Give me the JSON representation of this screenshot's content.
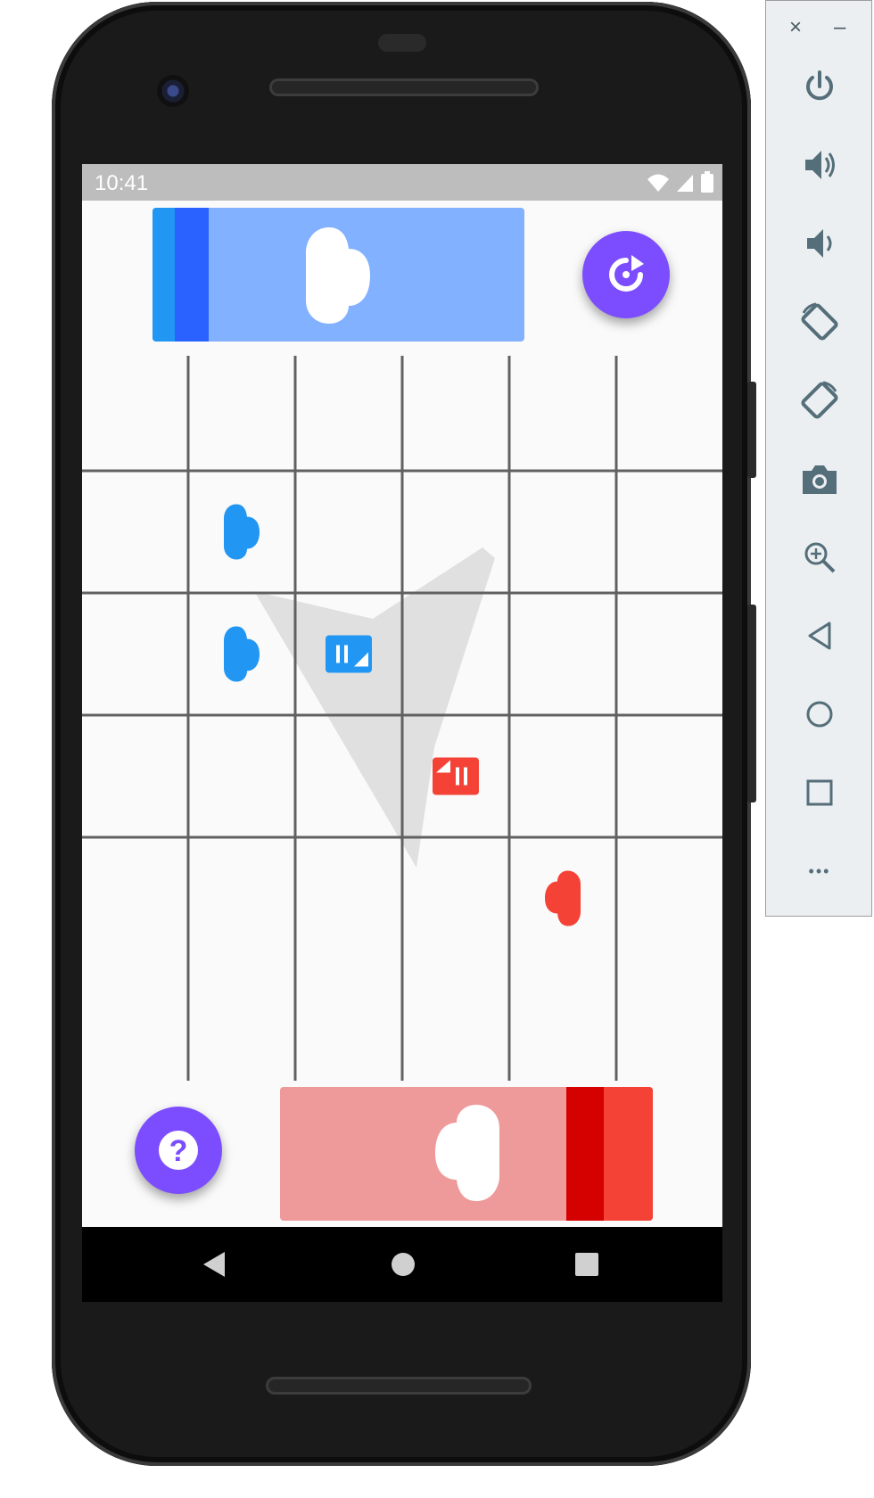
{
  "status_bar": {
    "time": "10:41"
  },
  "colors": {
    "blue_player": "#2196f3",
    "blue_panel": "#82b1ff",
    "blue_stripe_light": "#2196f3",
    "blue_stripe_dark": "#2962ff",
    "red_player": "#f44336",
    "red_panel": "#ef9a9a",
    "red_stripe_dark": "#d50000",
    "red_stripe_light": "#f44336",
    "fab": "#7c4dff",
    "screen_bg": "#fafafa"
  },
  "board": {
    "columns": 6,
    "rows": 6,
    "pieces": [
      {
        "player": "blue",
        "type": "cloud-piece",
        "col": 2,
        "row": 2
      },
      {
        "player": "blue",
        "type": "cloud-piece",
        "col": 2,
        "row": 3
      },
      {
        "player": "blue",
        "type": "note-piece",
        "col": 3,
        "row": 3
      },
      {
        "player": "red",
        "type": "note-piece",
        "col": 4,
        "row": 4
      },
      {
        "player": "red",
        "type": "cloud-piece",
        "col": 5,
        "row": 5
      }
    ]
  },
  "top_panel": {
    "icon": "cloud-icon",
    "player": "blue"
  },
  "bottom_panel": {
    "icon": "cloud-icon",
    "player": "red"
  },
  "buttons": {
    "restart_icon": "restart-icon",
    "help_icon": "help-icon",
    "help_glyph": "?"
  },
  "toolbar": {
    "close": "×",
    "minimize": "–",
    "items": [
      "power-icon",
      "volume-up-icon",
      "volume-down-icon",
      "rotate-left-icon",
      "rotate-right-icon",
      "camera-icon",
      "zoom-icon",
      "back-icon",
      "home-icon",
      "overview-icon",
      "more-icon"
    ],
    "more_glyph": "•••"
  }
}
